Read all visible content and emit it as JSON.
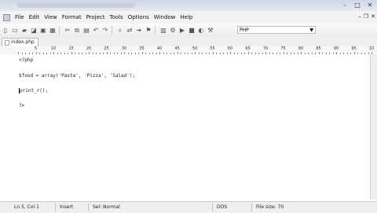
{
  "menu": [
    "File",
    "Edit",
    "View",
    "Format",
    "Project",
    "Tools",
    "Options",
    "Window",
    "Help"
  ],
  "toolbar": {
    "language": "PHP"
  },
  "tab": {
    "label": "index.php"
  },
  "ruler": {
    "labels": [
      "5",
      "10",
      "15",
      "20",
      "25",
      "30",
      "35",
      "40",
      "45",
      "50",
      "55",
      "60",
      "65",
      "70",
      "75",
      "80",
      "85",
      "90",
      "95",
      "10"
    ]
  },
  "code": [
    "<?php",
    "$food = array('Pasta', 'Pizza', 'Salad');",
    "print_r();",
    "?>"
  ],
  "status": {
    "position": "Ln 5, Col 1",
    "mode": "Insert",
    "syntax": "Sel: Normal",
    "line_ending": "DOS",
    "file_size": "File size: 70"
  }
}
